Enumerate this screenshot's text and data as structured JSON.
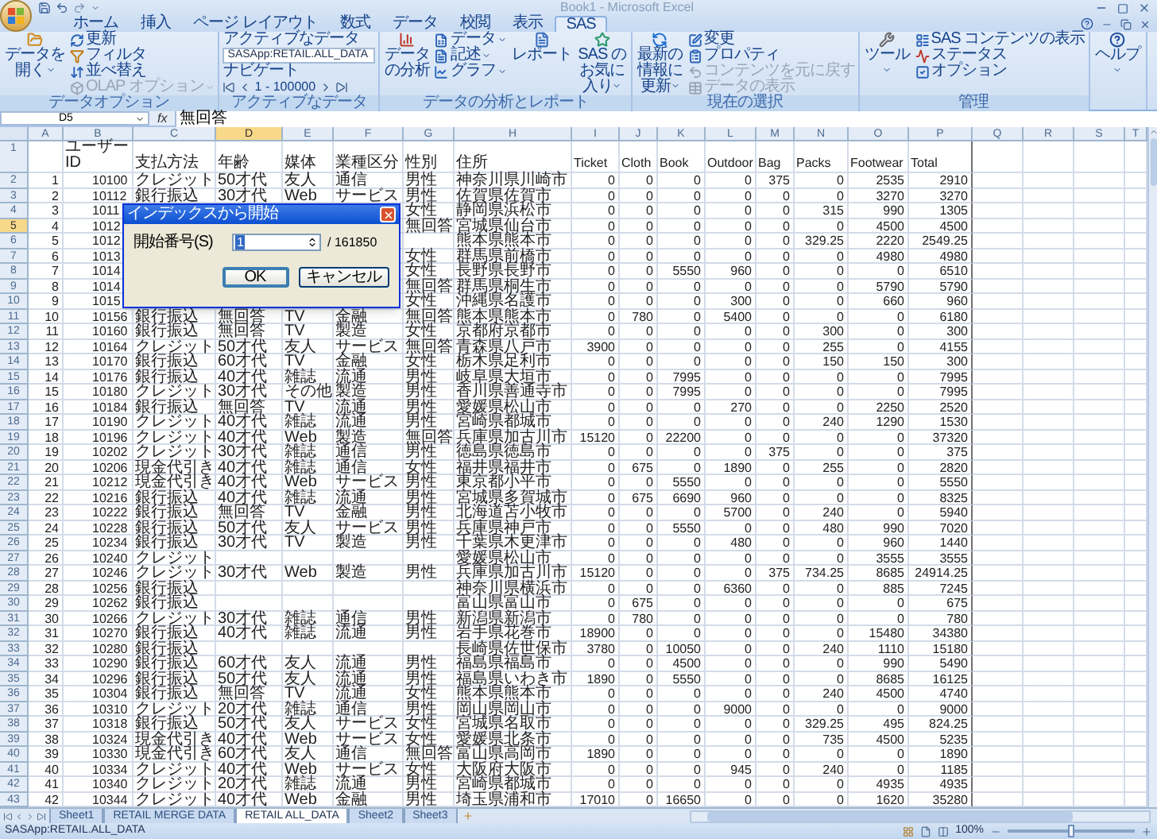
{
  "window": {
    "title": "Book1 - Microsoft Excel"
  },
  "tabs": [
    {
      "label": "ホーム",
      "selected": false
    },
    {
      "label": "挿入",
      "selected": false
    },
    {
      "label": "ページ レイアウト",
      "selected": false
    },
    {
      "label": "数式",
      "selected": false
    },
    {
      "label": "データ",
      "selected": false
    },
    {
      "label": "校閲",
      "selected": false
    },
    {
      "label": "表示",
      "selected": false
    },
    {
      "label": "SAS",
      "selected": true
    }
  ],
  "ribbon": {
    "groups": [
      {
        "label": "データオプション",
        "items": [
          {
            "kind": "large",
            "label": "データを開く",
            "menu": true,
            "disabled": false
          },
          {
            "kind": "stack",
            "items": [
              {
                "kind": "small",
                "label": "更新",
                "menu": false,
                "disabled": false
              },
              {
                "kind": "small",
                "label": "フィルタ",
                "menu": false,
                "disabled": false
              },
              {
                "kind": "small",
                "label": "並べ替え",
                "menu": false,
                "disabled": false
              },
              {
                "kind": "small",
                "label": "OLAP オプション",
                "menu": true,
                "disabled": true
              }
            ]
          }
        ]
      },
      {
        "label": "アクティブなデータ",
        "items": [
          {
            "kind": "stack",
            "items": [
              {
                "kind": "label",
                "label": "アクティブなデータ"
              },
              {
                "kind": "dropdown",
                "value": "SASApp:RETAIL.ALL_DATA"
              },
              {
                "kind": "label",
                "label": "ナビゲート"
              },
              {
                "kind": "nav",
                "range": "1 - 100000"
              }
            ]
          }
        ]
      },
      {
        "label": "データの分析とレポート",
        "items": [
          {
            "kind": "large",
            "label": "データの分析",
            "menu": false,
            "disabled": false
          },
          {
            "kind": "stack",
            "items": [
              {
                "kind": "small",
                "label": "データ",
                "menu": true,
                "disabled": false
              },
              {
                "kind": "small",
                "label": "記述",
                "menu": true,
                "disabled": false
              },
              {
                "kind": "small",
                "label": "グラフ",
                "menu": true,
                "disabled": false
              }
            ]
          },
          {
            "kind": "large",
            "label": "レポート",
            "menu": false,
            "disabled": false
          },
          {
            "kind": "large",
            "label": "SAS のお気に入り",
            "menu": true,
            "disabled": false
          }
        ]
      },
      {
        "label": "現在の選択",
        "items": [
          {
            "kind": "large",
            "label": "最新の情報に更新",
            "menu": true,
            "disabled": false
          },
          {
            "kind": "stack",
            "items": [
              {
                "kind": "small",
                "label": "変更",
                "menu": false,
                "disabled": false
              },
              {
                "kind": "small",
                "label": "プロパティ",
                "menu": false,
                "disabled": false
              },
              {
                "kind": "small",
                "label": "コンテンツを元に戻す",
                "menu": false,
                "disabled": true
              },
              {
                "kind": "small",
                "label": "データの表示",
                "menu": false,
                "disabled": true
              }
            ]
          }
        ]
      },
      {
        "label": "管理",
        "items": [
          {
            "kind": "large",
            "label": "ツール",
            "menu": true,
            "disabled": false
          },
          {
            "kind": "stack",
            "items": [
              {
                "kind": "small",
                "label": "SAS コンテンツの表示",
                "menu": false,
                "disabled": false
              },
              {
                "kind": "small",
                "label": "ステータス",
                "menu": false,
                "disabled": false
              },
              {
                "kind": "small",
                "label": "オプション",
                "menu": false,
                "disabled": false
              }
            ]
          }
        ]
      },
      {
        "items": [
          {
            "kind": "large",
            "label": "ヘルプ",
            "menu": true,
            "disabled": false
          }
        ]
      }
    ]
  },
  "formula_bar": {
    "name_box": "D5",
    "fx": "fx",
    "value": "無回答"
  },
  "grid": {
    "columns": [
      {
        "label": "A",
        "selected": false
      },
      {
        "label": "B",
        "selected": false
      },
      {
        "label": "C",
        "selected": false
      },
      {
        "label": "D",
        "selected": true
      },
      {
        "label": "E",
        "selected": false
      },
      {
        "label": "F",
        "selected": false
      },
      {
        "label": "G",
        "selected": false
      },
      {
        "label": "H",
        "selected": false
      },
      {
        "label": "I",
        "selected": false
      },
      {
        "label": "J",
        "selected": false
      },
      {
        "label": "K",
        "selected": false
      },
      {
        "label": "L",
        "selected": false
      },
      {
        "label": "M",
        "selected": false
      },
      {
        "label": "N",
        "selected": false
      },
      {
        "label": "O",
        "selected": false
      },
      {
        "label": "P",
        "selected": false
      },
      {
        "label": "Q",
        "selected": false
      },
      {
        "label": "R",
        "selected": false
      },
      {
        "label": "S",
        "selected": false
      },
      {
        "label": "T",
        "selected": false
      }
    ],
    "header_row": {
      "row": "1",
      "selected": false,
      "cells": {
        "B": "ユーザーID",
        "C": "支払方法",
        "D": "年齢",
        "E": "媒体",
        "F": "業種区分",
        "G": "性別",
        "H": "住所",
        "I": "Ticket",
        "J": "Cloth",
        "K": "Book",
        "L": "Outdoor",
        "M": "Bag",
        "N": "Packs",
        "O": "Footwear",
        "P": "Total"
      }
    },
    "rows": [
      {
        "row": "2",
        "selected": false,
        "cells": {
          "A": "1",
          "B": "10100",
          "C": "クレジット",
          "D": "50才代",
          "E": "友人",
          "F": "通信",
          "G": "男性",
          "H": "神奈川県川崎市",
          "I": "0",
          "J": "0",
          "K": "0",
          "L": "0",
          "M": "375",
          "N": "0",
          "O": "2535",
          "P": "2910"
        }
      },
      {
        "row": "3",
        "selected": false,
        "cells": {
          "A": "2",
          "B": "10112",
          "C": "銀行振込",
          "D": "30才代",
          "E": "Web",
          "F": "サービス",
          "G": "男性",
          "H": "佐賀県佐賀市",
          "I": "0",
          "J": "0",
          "K": "0",
          "L": "0",
          "M": "0",
          "N": "0",
          "O": "3270",
          "P": "3270"
        }
      },
      {
        "row": "4",
        "selected": false,
        "cells": {
          "A": "3",
          "B": "1011",
          "G": "女性",
          "H": "静岡県浜松市",
          "I": "0",
          "J": "0",
          "K": "0",
          "L": "0",
          "M": "0",
          "N": "315",
          "O": "990",
          "P": "1305"
        }
      },
      {
        "row": "5",
        "selected": true,
        "cells": {
          "A": "4",
          "B": "1012",
          "G": "無回答",
          "H": "宮城県仙台市",
          "I": "0",
          "J": "0",
          "K": "0",
          "L": "0",
          "M": "0",
          "N": "0",
          "O": "4500",
          "P": "4500"
        }
      },
      {
        "row": "6",
        "selected": false,
        "cells": {
          "A": "5",
          "B": "1012",
          "H": "熊本県熊本市",
          "I": "0",
          "J": "0",
          "K": "0",
          "L": "0",
          "M": "0",
          "N": "329.25",
          "O": "2220",
          "P": "2549.25"
        }
      },
      {
        "row": "7",
        "selected": false,
        "cells": {
          "A": "6",
          "B": "1013",
          "G": "女性",
          "H": "群馬県前橋市",
          "I": "0",
          "J": "0",
          "K": "0",
          "L": "0",
          "M": "0",
          "N": "0",
          "O": "4980",
          "P": "4980"
        }
      },
      {
        "row": "8",
        "selected": false,
        "cells": {
          "A": "7",
          "B": "1014",
          "G": "女性",
          "H": "長野県長野市",
          "I": "0",
          "J": "0",
          "K": "5550",
          "L": "960",
          "M": "0",
          "N": "0",
          "O": "0",
          "P": "6510"
        }
      },
      {
        "row": "9",
        "selected": false,
        "cells": {
          "A": "8",
          "B": "1014",
          "G": "無回答",
          "H": "群馬県桐生市",
          "I": "0",
          "J": "0",
          "K": "0",
          "L": "0",
          "M": "0",
          "N": "0",
          "O": "5790",
          "P": "5790"
        }
      },
      {
        "row": "10",
        "selected": false,
        "cells": {
          "A": "9",
          "B": "1015",
          "G": "女性",
          "H": "沖縄県名護市",
          "I": "0",
          "J": "0",
          "K": "0",
          "L": "300",
          "M": "0",
          "N": "0",
          "O": "660",
          "P": "960"
        }
      },
      {
        "row": "11",
        "selected": false,
        "cells": {
          "A": "10",
          "B": "10156",
          "C": "銀行振込",
          "D": "無回答",
          "E": "TV",
          "F": "金融",
          "G": "無回答",
          "H": "熊本県熊本市",
          "I": "0",
          "J": "780",
          "K": "0",
          "L": "5400",
          "M": "0",
          "N": "0",
          "O": "0",
          "P": "6180"
        }
      },
      {
        "row": "12",
        "selected": false,
        "cells": {
          "A": "11",
          "B": "10160",
          "C": "銀行振込",
          "D": "無回答",
          "E": "TV",
          "F": "製造",
          "G": "女性",
          "H": "京都府京都市",
          "I": "0",
          "J": "0",
          "K": "0",
          "L": "0",
          "M": "0",
          "N": "300",
          "O": "0",
          "P": "300"
        }
      },
      {
        "row": "13",
        "selected": false,
        "cells": {
          "A": "12",
          "B": "10164",
          "C": "クレジット",
          "D": "50才代",
          "E": "友人",
          "F": "サービス",
          "G": "無回答",
          "H": "青森県八戸市",
          "I": "3900",
          "J": "0",
          "K": "0",
          "L": "0",
          "M": "0",
          "N": "255",
          "O": "0",
          "P": "4155"
        }
      },
      {
        "row": "14",
        "selected": false,
        "cells": {
          "A": "13",
          "B": "10170",
          "C": "銀行振込",
          "D": "60才代",
          "E": "TV",
          "F": "金融",
          "G": "女性",
          "H": "栃木県足利市",
          "I": "0",
          "J": "0",
          "K": "0",
          "L": "0",
          "M": "0",
          "N": "150",
          "O": "150",
          "P": "300"
        }
      },
      {
        "row": "15",
        "selected": false,
        "cells": {
          "A": "14",
          "B": "10176",
          "C": "銀行振込",
          "D": "40才代",
          "E": "雑誌",
          "F": "流通",
          "G": "男性",
          "H": "岐阜県大垣市",
          "I": "0",
          "J": "0",
          "K": "7995",
          "L": "0",
          "M": "0",
          "N": "0",
          "O": "0",
          "P": "7995"
        }
      },
      {
        "row": "16",
        "selected": false,
        "cells": {
          "A": "15",
          "B": "10180",
          "C": "クレジット",
          "D": "30才代",
          "E": "その他",
          "F": "製造",
          "G": "男性",
          "H": "香川県善通寺市",
          "I": "0",
          "J": "0",
          "K": "7995",
          "L": "0",
          "M": "0",
          "N": "0",
          "O": "0",
          "P": "7995"
        }
      },
      {
        "row": "17",
        "selected": false,
        "cells": {
          "A": "16",
          "B": "10184",
          "C": "銀行振込",
          "D": "無回答",
          "E": "TV",
          "F": "流通",
          "G": "男性",
          "H": "愛媛県松山市",
          "I": "0",
          "J": "0",
          "K": "0",
          "L": "270",
          "M": "0",
          "N": "0",
          "O": "2250",
          "P": "2520"
        }
      },
      {
        "row": "18",
        "selected": false,
        "cells": {
          "A": "17",
          "B": "10190",
          "C": "クレジット",
          "D": "40才代",
          "E": "雑誌",
          "F": "流通",
          "G": "男性",
          "H": "宮崎県都城市",
          "I": "0",
          "J": "0",
          "K": "0",
          "L": "0",
          "M": "0",
          "N": "240",
          "O": "1290",
          "P": "1530"
        }
      },
      {
        "row": "19",
        "selected": false,
        "cells": {
          "A": "18",
          "B": "10196",
          "C": "クレジット",
          "D": "40才代",
          "E": "Web",
          "F": "製造",
          "G": "無回答",
          "H": "兵庫県加古川市",
          "I": "15120",
          "J": "0",
          "K": "22200",
          "L": "0",
          "M": "0",
          "N": "0",
          "O": "0",
          "P": "37320"
        }
      },
      {
        "row": "20",
        "selected": false,
        "cells": {
          "A": "19",
          "B": "10202",
          "C": "クレジット",
          "D": "30才代",
          "E": "雑誌",
          "F": "通信",
          "G": "男性",
          "H": "徳島県徳島市",
          "I": "0",
          "J": "0",
          "K": "0",
          "L": "0",
          "M": "375",
          "N": "0",
          "O": "0",
          "P": "375"
        }
      },
      {
        "row": "21",
        "selected": false,
        "cells": {
          "A": "20",
          "B": "10206",
          "C": "現金代引き",
          "D": "40才代",
          "E": "雑誌",
          "F": "通信",
          "G": "女性",
          "H": "福井県福井市",
          "I": "0",
          "J": "675",
          "K": "0",
          "L": "1890",
          "M": "0",
          "N": "255",
          "O": "0",
          "P": "2820"
        }
      },
      {
        "row": "22",
        "selected": false,
        "cells": {
          "A": "21",
          "B": "10212",
          "C": "現金代引き",
          "D": "40才代",
          "E": "Web",
          "F": "サービス",
          "G": "男性",
          "H": "東京都小平市",
          "I": "0",
          "J": "0",
          "K": "5550",
          "L": "0",
          "M": "0",
          "N": "0",
          "O": "0",
          "P": "5550"
        }
      },
      {
        "row": "23",
        "selected": false,
        "cells": {
          "A": "22",
          "B": "10216",
          "C": "銀行振込",
          "D": "40才代",
          "E": "雑誌",
          "F": "流通",
          "G": "男性",
          "H": "宮城県多賀城市",
          "I": "0",
          "J": "675",
          "K": "6690",
          "L": "960",
          "M": "0",
          "N": "0",
          "O": "0",
          "P": "8325"
        }
      },
      {
        "row": "24",
        "selected": false,
        "cells": {
          "A": "23",
          "B": "10222",
          "C": "銀行振込",
          "D": "無回答",
          "E": "TV",
          "F": "金融",
          "G": "男性",
          "H": "北海道苫小牧市",
          "I": "0",
          "J": "0",
          "K": "0",
          "L": "5700",
          "M": "0",
          "N": "240",
          "O": "0",
          "P": "5940"
        }
      },
      {
        "row": "25",
        "selected": false,
        "cells": {
          "A": "24",
          "B": "10228",
          "C": "銀行振込",
          "D": "50才代",
          "E": "友人",
          "F": "サービス",
          "G": "男性",
          "H": "兵庫県神戸市",
          "I": "0",
          "J": "0",
          "K": "5550",
          "L": "0",
          "M": "0",
          "N": "480",
          "O": "990",
          "P": "7020"
        }
      },
      {
        "row": "26",
        "selected": false,
        "cells": {
          "A": "25",
          "B": "10234",
          "C": "銀行振込",
          "D": "30才代",
          "E": "TV",
          "F": "製造",
          "G": "男性",
          "H": "千葉県木更津市",
          "I": "0",
          "J": "0",
          "K": "0",
          "L": "480",
          "M": "0",
          "N": "0",
          "O": "960",
          "P": "1440"
        }
      },
      {
        "row": "27",
        "selected": false,
        "cells": {
          "A": "26",
          "B": "10240",
          "C": "クレジット",
          "H": "愛媛県松山市",
          "I": "0",
          "J": "0",
          "K": "0",
          "L": "0",
          "M": "0",
          "N": "0",
          "O": "3555",
          "P": "3555"
        }
      },
      {
        "row": "28",
        "selected": false,
        "cells": {
          "A": "27",
          "B": "10246",
          "C": "クレジット",
          "D": "30才代",
          "E": "Web",
          "F": "製造",
          "G": "男性",
          "H": "兵庫県加古川市",
          "I": "15120",
          "J": "0",
          "K": "0",
          "L": "0",
          "M": "375",
          "N": "734.25",
          "O": "8685",
          "P": "24914.25"
        }
      },
      {
        "row": "29",
        "selected": false,
        "cells": {
          "A": "28",
          "B": "10256",
          "C": "銀行振込",
          "H": "神奈川県横浜市",
          "I": "0",
          "J": "0",
          "K": "0",
          "L": "6360",
          "M": "0",
          "N": "0",
          "O": "885",
          "P": "7245"
        }
      },
      {
        "row": "30",
        "selected": false,
        "cells": {
          "A": "29",
          "B": "10262",
          "C": "銀行振込",
          "H": "富山県富山市",
          "I": "0",
          "J": "675",
          "K": "0",
          "L": "0",
          "M": "0",
          "N": "0",
          "O": "0",
          "P": "675"
        }
      },
      {
        "row": "31",
        "selected": false,
        "cells": {
          "A": "30",
          "B": "10266",
          "C": "クレジット",
          "D": "30才代",
          "E": "雑誌",
          "F": "通信",
          "G": "男性",
          "H": "新潟県新潟市",
          "I": "0",
          "J": "780",
          "K": "0",
          "L": "0",
          "M": "0",
          "N": "0",
          "O": "0",
          "P": "780"
        }
      },
      {
        "row": "32",
        "selected": false,
        "cells": {
          "A": "31",
          "B": "10270",
          "C": "銀行振込",
          "D": "40才代",
          "E": "雑誌",
          "F": "流通",
          "G": "男性",
          "H": "岩手県花巻市",
          "I": "18900",
          "J": "0",
          "K": "0",
          "L": "0",
          "M": "0",
          "N": "0",
          "O": "15480",
          "P": "34380"
        }
      },
      {
        "row": "33",
        "selected": false,
        "cells": {
          "A": "32",
          "B": "10280",
          "C": "銀行振込",
          "H": "長崎県佐世保市",
          "I": "3780",
          "J": "0",
          "K": "10050",
          "L": "0",
          "M": "0",
          "N": "240",
          "O": "1110",
          "P": "15180"
        }
      },
      {
        "row": "34",
        "selected": false,
        "cells": {
          "A": "33",
          "B": "10290",
          "C": "銀行振込",
          "D": "60才代",
          "E": "友人",
          "F": "流通",
          "G": "男性",
          "H": "福島県福島市",
          "I": "0",
          "J": "0",
          "K": "4500",
          "L": "0",
          "M": "0",
          "N": "0",
          "O": "990",
          "P": "5490"
        }
      },
      {
        "row": "35",
        "selected": false,
        "cells": {
          "A": "34",
          "B": "10296",
          "C": "銀行振込",
          "D": "50才代",
          "E": "友人",
          "F": "流通",
          "G": "男性",
          "H": "福島県いわき市",
          "I": "1890",
          "J": "0",
          "K": "5550",
          "L": "0",
          "M": "0",
          "N": "0",
          "O": "8685",
          "P": "16125"
        }
      },
      {
        "row": "36",
        "selected": false,
        "cells": {
          "A": "35",
          "B": "10304",
          "C": "銀行振込",
          "D": "無回答",
          "E": "TV",
          "F": "流通",
          "G": "女性",
          "H": "熊本県熊本市",
          "I": "0",
          "J": "0",
          "K": "0",
          "L": "0",
          "M": "0",
          "N": "240",
          "O": "4500",
          "P": "4740"
        }
      },
      {
        "row": "37",
        "selected": false,
        "cells": {
          "A": "36",
          "B": "10310",
          "C": "クレジット",
          "D": "20才代",
          "E": "雑誌",
          "F": "通信",
          "G": "男性",
          "H": "岡山県岡山市",
          "I": "0",
          "J": "0",
          "K": "0",
          "L": "9000",
          "M": "0",
          "N": "0",
          "O": "0",
          "P": "9000"
        }
      },
      {
        "row": "38",
        "selected": false,
        "cells": {
          "A": "37",
          "B": "10318",
          "C": "銀行振込",
          "D": "50才代",
          "E": "友人",
          "F": "サービス",
          "G": "女性",
          "H": "宮城県名取市",
          "I": "0",
          "J": "0",
          "K": "0",
          "L": "0",
          "M": "0",
          "N": "329.25",
          "O": "495",
          "P": "824.25"
        }
      },
      {
        "row": "39",
        "selected": false,
        "cells": {
          "A": "38",
          "B": "10324",
          "C": "現金代引き",
          "D": "40才代",
          "E": "Web",
          "F": "サービス",
          "G": "女性",
          "H": "愛媛県北条市",
          "I": "0",
          "J": "0",
          "K": "0",
          "L": "0",
          "M": "0",
          "N": "735",
          "O": "4500",
          "P": "5235"
        }
      },
      {
        "row": "40",
        "selected": false,
        "cells": {
          "A": "39",
          "B": "10330",
          "C": "現金代引き",
          "D": "60才代",
          "E": "友人",
          "F": "通信",
          "G": "無回答",
          "H": "富山県高岡市",
          "I": "1890",
          "J": "0",
          "K": "0",
          "L": "0",
          "M": "0",
          "N": "0",
          "O": "0",
          "P": "1890"
        }
      },
      {
        "row": "41",
        "selected": false,
        "cells": {
          "A": "40",
          "B": "10334",
          "C": "クレジット",
          "D": "40才代",
          "E": "Web",
          "F": "サービス",
          "G": "女性",
          "H": "大阪府大阪市",
          "I": "0",
          "J": "0",
          "K": "0",
          "L": "945",
          "M": "0",
          "N": "240",
          "O": "0",
          "P": "1185"
        }
      },
      {
        "row": "42",
        "selected": false,
        "cells": {
          "A": "41",
          "B": "10340",
          "C": "クレジット",
          "D": "20才代",
          "E": "雑誌",
          "F": "流通",
          "G": "男性",
          "H": "宮崎県都城市",
          "I": "0",
          "J": "0",
          "K": "0",
          "L": "0",
          "M": "0",
          "N": "0",
          "O": "4935",
          "P": "4935"
        }
      },
      {
        "row": "43",
        "selected": false,
        "cells": {
          "A": "42",
          "B": "10344",
          "C": "クレジット",
          "D": "40才代",
          "E": "Web",
          "F": "金融",
          "G": "男性",
          "H": "埼玉県浦和市",
          "I": "17010",
          "J": "0",
          "K": "16650",
          "L": "0",
          "M": "0",
          "N": "0",
          "O": "1620",
          "P": "35280"
        }
      }
    ]
  },
  "dialog": {
    "title": "インデックスから開始",
    "label": "開始番号(S)",
    "value": "1",
    "total": "/ 161850",
    "buttons": [
      "OK",
      "キャンセル"
    ]
  },
  "sheet_tabs": [
    {
      "label": "Sheet1",
      "selected": false
    },
    {
      "label": "RETAIL MERGE DATA",
      "selected": false
    },
    {
      "label": "RETAIL ALL_DATA",
      "selected": true
    },
    {
      "label": "Sheet2",
      "selected": false
    },
    {
      "label": "Sheet3",
      "selected": false
    }
  ],
  "status_bar": {
    "text": "SASApp:RETAIL.ALL_DATA",
    "zoom": "100%",
    "zoom_slider": {
      "level": 0.5
    }
  }
}
